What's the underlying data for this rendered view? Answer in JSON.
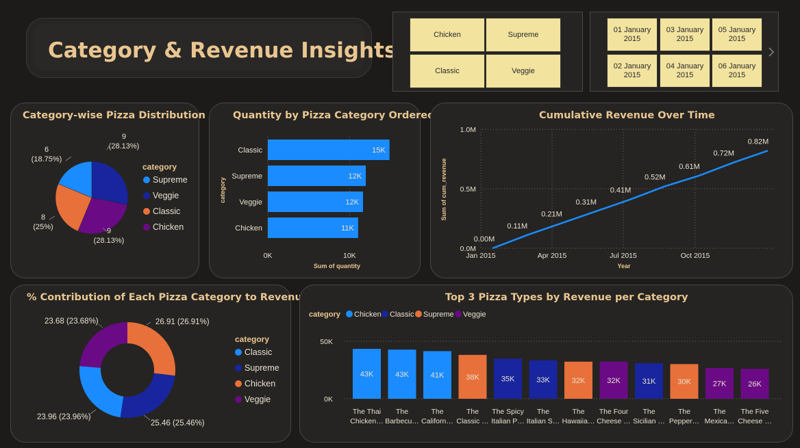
{
  "title": "Category & Revenue Insights",
  "colors": {
    "chicken": "#1a8cff",
    "classic": "#e8703a",
    "supreme": "#18259e",
    "veggie": "#6b0a85",
    "accent": "#e9c691"
  },
  "category_slicer": {
    "items": [
      "Chicken",
      "Supreme",
      "Classic",
      "Veggie"
    ]
  },
  "date_slicer": {
    "items": [
      "01 January 2015",
      "03 January 2015",
      "05 January 2015",
      "02 January 2015",
      "04 January 2015",
      "06 January 2015"
    ],
    "next_icon": "chevron-right-icon"
  },
  "pie_panel": {
    "title": "Category-wise Pizza Distribution",
    "legend_title": "category",
    "legend": [
      "Supreme",
      "Veggie",
      "Classic",
      "Chicken"
    ],
    "chart_data": {
      "type": "pie",
      "title": "Category-wise Pizza Distribution",
      "slices": [
        {
          "name": "Supreme",
          "value": 9,
          "label": "9",
          "pct": "(28.13%)"
        },
        {
          "name": "Veggie",
          "value": 9,
          "label": "9",
          "pct": "(28.13%)"
        },
        {
          "name": "Classic",
          "value": 8,
          "label": "8",
          "pct": "(25%)"
        },
        {
          "name": "Chicken",
          "value": 6,
          "label": "6",
          "pct": "(18.75%)"
        }
      ]
    }
  },
  "bar_panel": {
    "title": "Quantity by Pizza Category Ordered",
    "chart_data": {
      "type": "bar",
      "orientation": "horizontal",
      "title": "Quantity by Pizza Category Ordered",
      "xlabel": "Sum of quantity",
      "ylabel": "category",
      "categories": [
        "Classic",
        "Supreme",
        "Veggie",
        "Chicken"
      ],
      "values": [
        14888,
        11987,
        11649,
        11050
      ],
      "data_labels": [
        "15K",
        "12K",
        "12K",
        "11K"
      ],
      "xticks": [
        "0K",
        "10K"
      ],
      "xlim": [
        0,
        15000
      ]
    }
  },
  "line_panel": {
    "title": "Cumulative Revenue Over Time",
    "chart_data": {
      "type": "line",
      "title": "Cumulative Revenue Over Time",
      "xlabel": "Year",
      "ylabel": "Sum of cum_revenue",
      "yticks": [
        "0.0M",
        "0.5M",
        "1.0M"
      ],
      "ylim": [
        0,
        1.0
      ],
      "xticks": [
        "Jan 2015",
        "Apr 2015",
        "Jul 2015",
        "Oct 2015"
      ],
      "points": [
        {
          "x": "2015-01",
          "y": 0.0
        },
        {
          "x": "2015-02",
          "y": 0.11
        },
        {
          "x": "2015-03",
          "y": 0.21
        },
        {
          "x": "2015-04",
          "y": 0.31
        },
        {
          "x": "2015-05",
          "y": 0.41
        },
        {
          "x": "2015-06",
          "y": 0.52
        },
        {
          "x": "2015-07",
          "y": 0.61
        },
        {
          "x": "2015-08",
          "y": 0.72
        },
        {
          "x": "2015-09",
          "y": 0.82
        }
      ],
      "data_labels": [
        "0.00M",
        "0.11M",
        "0.21M",
        "0.31M",
        "0.41M",
        "0.52M",
        "0.61M",
        "0.72M",
        "0.82M"
      ]
    }
  },
  "donut_panel": {
    "title": "% Contribution of Each Pizza Category to Revenue",
    "legend_title": "category",
    "legend": [
      "Classic",
      "Supreme",
      "Chicken",
      "Veggie"
    ],
    "chart_data": {
      "type": "pie",
      "variant": "donut",
      "title": "% Contribution of Each Pizza Category to Revenue",
      "slices": [
        {
          "name": "Classic",
          "value": 26.91,
          "label": "26.91 (26.91%)"
        },
        {
          "name": "Supreme",
          "value": 25.46,
          "label": "25.46 (25.46%)"
        },
        {
          "name": "Chicken",
          "value": 23.96,
          "label": "23.96 (23.96%)"
        },
        {
          "name": "Veggie",
          "value": 23.68,
          "label": "23.68 (23.68%)"
        }
      ]
    }
  },
  "top_panel": {
    "title": "Top 3 Pizza Types by Revenue per Category",
    "legend_title": "category",
    "legend": [
      "Chicken",
      "Classic",
      "Supreme",
      "Veggie"
    ],
    "chart_data": {
      "type": "bar",
      "title": "Top 3 Pizza Types by Revenue per Category",
      "yticks": [
        "0K",
        "50K"
      ],
      "ylim": [
        0,
        50000
      ],
      "bars": [
        {
          "label1": "The Thai",
          "label2": "Chicken…",
          "value": 43434,
          "text": "43K",
          "series": "chicken"
        },
        {
          "label1": "The",
          "label2": "Barbecu…",
          "value": 42768,
          "text": "43K",
          "series": "chicken"
        },
        {
          "label1": "The",
          "label2": "Californ…",
          "value": 41410,
          "text": "41K",
          "series": "chicken"
        },
        {
          "label1": "The",
          "label2": "Classic …",
          "value": 38180,
          "text": "38K",
          "series": "classic"
        },
        {
          "label1": "The Spicy",
          "label2": "Italian P…",
          "value": 34831,
          "text": "35K",
          "series": "supreme"
        },
        {
          "label1": "The",
          "label2": "Italian S…",
          "value": 33476,
          "text": "33K",
          "series": "supreme"
        },
        {
          "label1": "The",
          "label2": "Hawaiia…",
          "value": 32273,
          "text": "32K",
          "series": "classic"
        },
        {
          "label1": "The Four",
          "label2": "Cheese …",
          "value": 32265,
          "text": "32K",
          "series": "veggie"
        },
        {
          "label1": "The",
          "label2": "Sicilian …",
          "value": 30940,
          "text": "31K",
          "series": "supreme"
        },
        {
          "label1": "The",
          "label2": "Pepper…",
          "value": 30161,
          "text": "30K",
          "series": "classic"
        },
        {
          "label1": "The",
          "label2": "Mexica…",
          "value": 26780,
          "text": "27K",
          "series": "veggie"
        },
        {
          "label1": "The Five",
          "label2": "Cheese …",
          "value": 26066,
          "text": "26K",
          "series": "veggie"
        }
      ]
    }
  }
}
